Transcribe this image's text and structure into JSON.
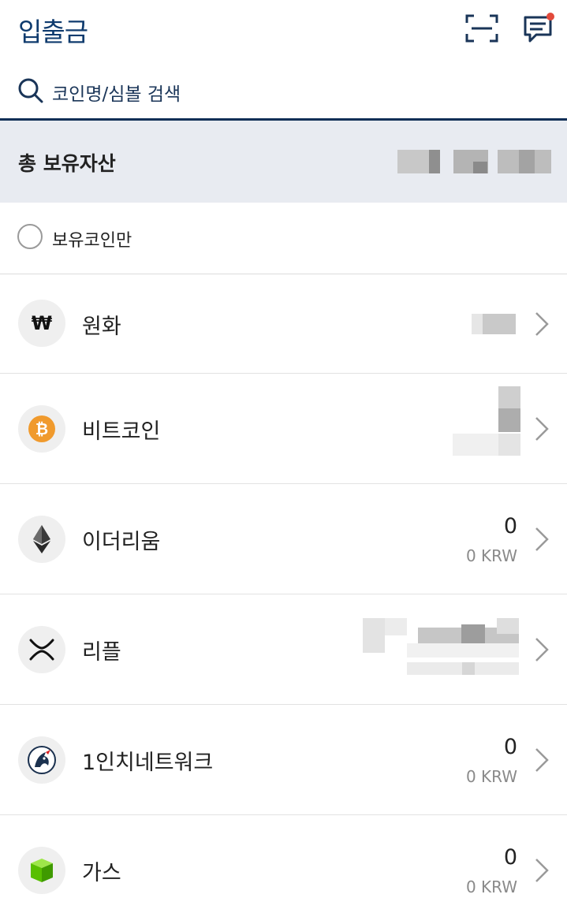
{
  "header": {
    "title": "입출금",
    "scan_icon": "qr-scan-icon",
    "chat_icon": "chat-notification-icon",
    "notification_color": "#e24a3b"
  },
  "search": {
    "placeholder": "코인명/심볼 검색",
    "icon": "search-icon"
  },
  "total": {
    "label": "총 보유자산",
    "value_obscured": true
  },
  "filter": {
    "label": "보유코인만",
    "checked": false
  },
  "coins": [
    {
      "name": "원화",
      "icon": "won-icon",
      "amount_obscured": true
    },
    {
      "name": "비트코인",
      "icon": "bitcoin-icon",
      "icon_color": "#f09a2d",
      "amount_obscured": true
    },
    {
      "name": "이더리움",
      "icon": "ethereum-icon",
      "amount": "0",
      "krw": "0 KRW"
    },
    {
      "name": "리플",
      "icon": "ripple-icon",
      "amount_obscured": true
    },
    {
      "name": "1인치네트워크",
      "icon": "1inch-icon",
      "amount": "0",
      "krw": "0 KRW"
    },
    {
      "name": "가스",
      "icon": "gas-icon",
      "icon_color": "#58bf00",
      "amount": "0",
      "krw": "0 KRW"
    }
  ],
  "colors": {
    "brand": "#0f3b6e",
    "total_bg": "#e8ebf1",
    "divider": "#0f2e56"
  }
}
